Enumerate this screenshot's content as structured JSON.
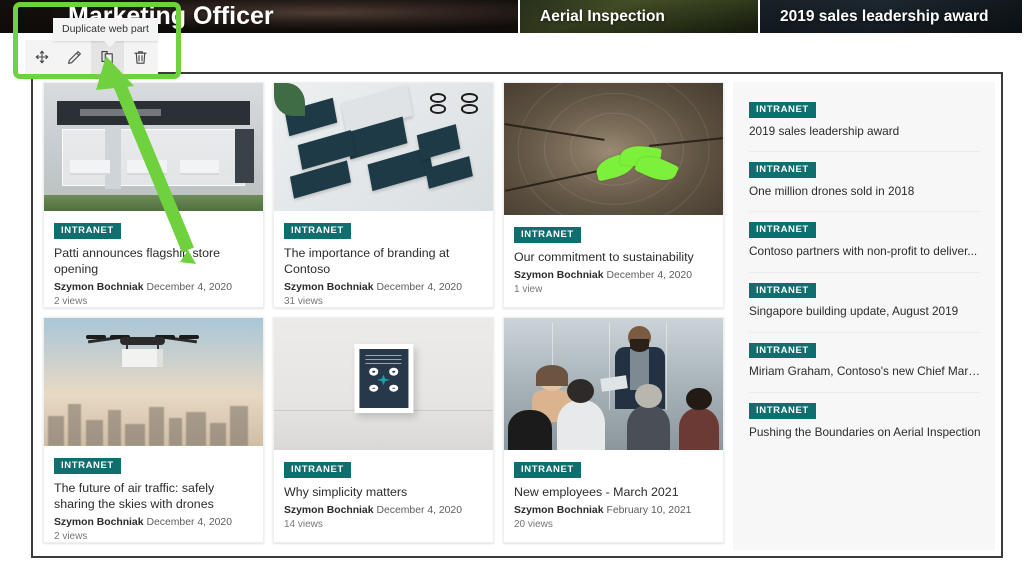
{
  "hero": {
    "tiles": [
      {
        "title": "Marketing Officer"
      },
      {
        "title": "Aerial Inspection"
      },
      {
        "title": "2019 sales leadership award"
      }
    ]
  },
  "toolbar": {
    "tooltip": "Duplicate web part",
    "buttons": [
      {
        "name": "move-web-part",
        "icon": "move-icon",
        "label": "Move web part"
      },
      {
        "name": "edit-web-part",
        "icon": "pencil-icon",
        "label": "Edit web part"
      },
      {
        "name": "duplicate-web-part",
        "icon": "duplicate-icon",
        "label": "Duplicate web part"
      },
      {
        "name": "delete-web-part",
        "icon": "trash-icon",
        "label": "Delete web part"
      }
    ]
  },
  "annotation": {
    "highlight_color": "#6fd13d",
    "arrow_color": "#6fd13d"
  },
  "news": {
    "badge_color": "#0f6e6e",
    "cards": [
      {
        "badge": "INTRANET",
        "title": "Patti announces flagship store opening",
        "author": "Szymon Bochniak",
        "date": "December 4, 2020",
        "views": "2 views",
        "thumb": "retail-store-photo"
      },
      {
        "badge": "INTRANET",
        "title": "The importance of branding at Contoso",
        "author": "Szymon Bochniak",
        "date": "December 4, 2020",
        "views": "31 views",
        "thumb": "devices-collage-photo"
      },
      {
        "badge": "INTRANET",
        "title": "Our commitment to sustainability",
        "author": "Szymon Bochniak",
        "date": "December 4, 2020",
        "views": "1 view",
        "thumb": "sprout-on-wood-photo"
      },
      {
        "badge": "INTRANET",
        "title": "The future of air traffic: safely sharing the skies with drones",
        "author": "Szymon Bochniak",
        "date": "December 4, 2020",
        "views": "2 views",
        "thumb": "delivery-drone-city-photo"
      },
      {
        "badge": "INTRANET",
        "title": "Why simplicity matters",
        "author": "Szymon Bochniak",
        "date": "December 4, 2020",
        "views": "14 views",
        "thumb": "framed-poster-photo"
      },
      {
        "badge": "INTRANET",
        "title": "New employees - March 2021",
        "author": "Szymon Bochniak",
        "date": "February 10, 2021",
        "views": "20 views",
        "thumb": "meeting-presentation-photo"
      }
    ]
  },
  "sidebar": {
    "items": [
      {
        "badge": "INTRANET",
        "title": "2019 sales leadership award"
      },
      {
        "badge": "INTRANET",
        "title": "One million drones sold in 2018"
      },
      {
        "badge": "INTRANET",
        "title": "Contoso partners with non-profit to deliver..."
      },
      {
        "badge": "INTRANET",
        "title": "Singapore building update, August 2019"
      },
      {
        "badge": "INTRANET",
        "title": "Miriam Graham, Contoso's new Chief Mark..."
      },
      {
        "badge": "INTRANET",
        "title": "Pushing the Boundaries on Aerial Inspection"
      }
    ]
  }
}
